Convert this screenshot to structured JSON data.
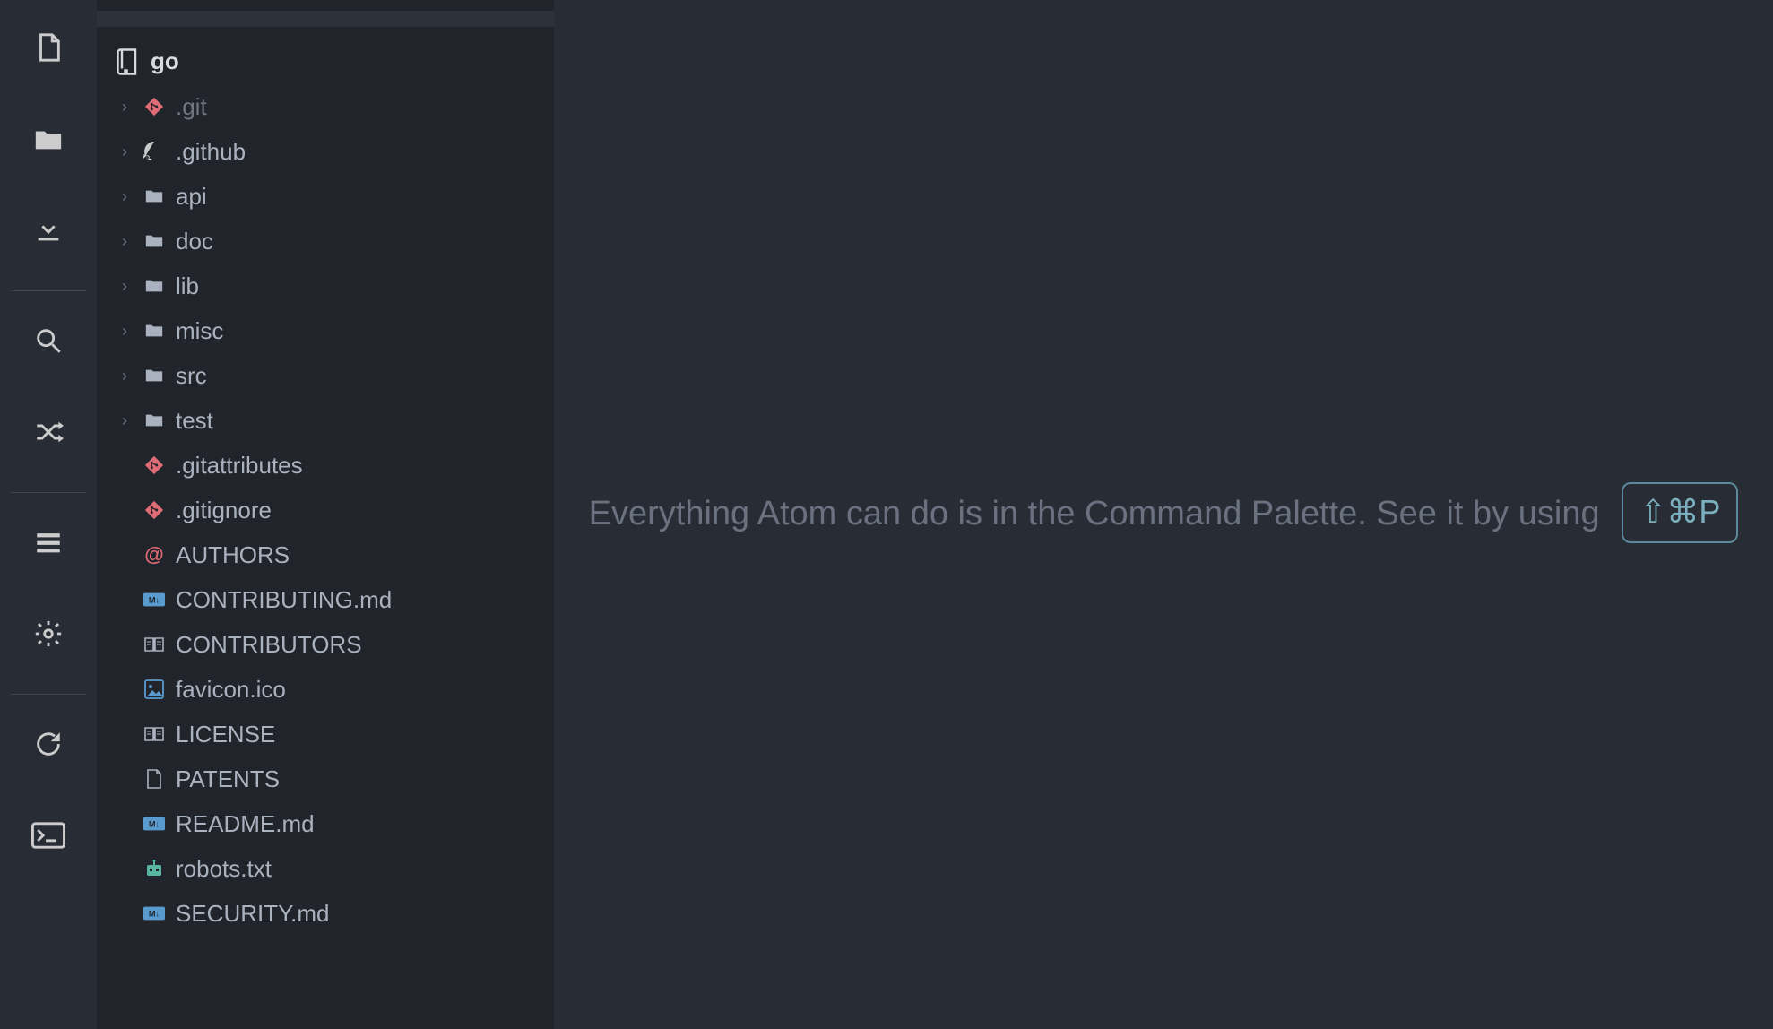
{
  "project": {
    "root_name": "go"
  },
  "tree": [
    {
      "type": "folder",
      "name": ".git",
      "icon": "git",
      "dim": true
    },
    {
      "type": "folder",
      "name": ".github",
      "icon": "github",
      "dim": false
    },
    {
      "type": "folder",
      "name": "api",
      "icon": "folder",
      "dim": false
    },
    {
      "type": "folder",
      "name": "doc",
      "icon": "folder",
      "dim": false
    },
    {
      "type": "folder",
      "name": "lib",
      "icon": "folder",
      "dim": false
    },
    {
      "type": "folder",
      "name": "misc",
      "icon": "folder",
      "dim": false
    },
    {
      "type": "folder",
      "name": "src",
      "icon": "folder",
      "dim": false
    },
    {
      "type": "folder",
      "name": "test",
      "icon": "folder",
      "dim": false
    },
    {
      "type": "file",
      "name": ".gitattributes",
      "icon": "git",
      "dim": false
    },
    {
      "type": "file",
      "name": ".gitignore",
      "icon": "git",
      "dim": false
    },
    {
      "type": "file",
      "name": "AUTHORS",
      "icon": "at",
      "dim": false
    },
    {
      "type": "file",
      "name": "CONTRIBUTING.md",
      "icon": "md",
      "dim": false
    },
    {
      "type": "file",
      "name": "CONTRIBUTORS",
      "icon": "book",
      "dim": false
    },
    {
      "type": "file",
      "name": "favicon.ico",
      "icon": "image",
      "dim": false
    },
    {
      "type": "file",
      "name": "LICENSE",
      "icon": "book",
      "dim": false
    },
    {
      "type": "file",
      "name": "PATENTS",
      "icon": "pagedoc",
      "dim": false
    },
    {
      "type": "file",
      "name": "README.md",
      "icon": "md",
      "dim": false
    },
    {
      "type": "file",
      "name": "robots.txt",
      "icon": "robot",
      "dim": false
    },
    {
      "type": "file",
      "name": "SECURITY.md",
      "icon": "md",
      "dim": false
    }
  ],
  "welcome": {
    "text_before": "Everything Atom can do is in the Command Palette. See it by using",
    "shortcut": "⇧⌘P"
  }
}
